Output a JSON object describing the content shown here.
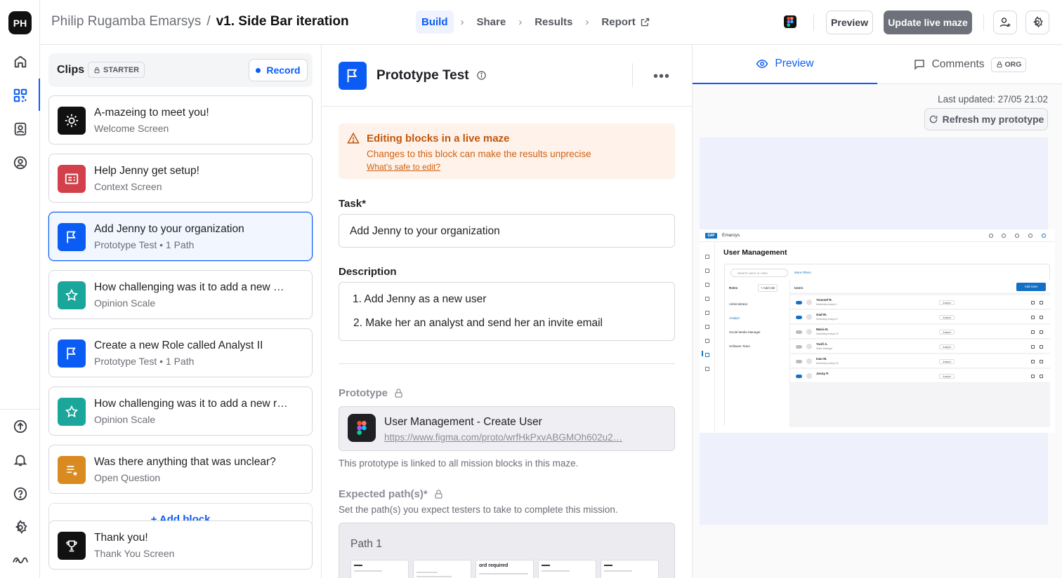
{
  "user": {
    "initials": "PH"
  },
  "header": {
    "workspace": "Philip Rugamba Emarsys",
    "separator": "/",
    "maze_name": "v1. Side Bar iteration",
    "steps": [
      "Build",
      "Share",
      "Results",
      "Report"
    ],
    "active_step": "Build",
    "preview_label": "Preview",
    "update_label": "Update live maze"
  },
  "clips": {
    "title": "Clips",
    "plan_badge": "STARTER",
    "record_label": "Record",
    "add_block_label": "+ Add block",
    "blocks": [
      {
        "title": "A-mazeing to meet you!",
        "subtitle": "Welcome Screen",
        "icon": "sun-icon",
        "color": "#111111"
      },
      {
        "title": "Help Jenny get setup!",
        "subtitle": "Context Screen",
        "icon": "context-screen-icon",
        "color": "#d2414b"
      },
      {
        "title": "Add Jenny to your organization",
        "subtitle": "Prototype Test • 1 Path",
        "icon": "flag-icon",
        "color": "#0a5cf5",
        "selected": true
      },
      {
        "title": "How challenging was it to add a new …",
        "subtitle": "Opinion Scale",
        "icon": "star-icon",
        "color": "#1aa69a"
      },
      {
        "title": "Create a new Role called Analyst II",
        "subtitle": "Prototype Test • 1 Path",
        "icon": "flag-icon",
        "color": "#0a5cf5"
      },
      {
        "title": "How challenging was it to add a new r…",
        "subtitle": "Opinion Scale",
        "icon": "star-icon",
        "color": "#1aa69a"
      },
      {
        "title": "Was there anything that was unclear?",
        "subtitle": "Open Question",
        "icon": "open-question-icon",
        "color": "#d98a21"
      },
      {
        "title": "Thank you!",
        "subtitle": "Thank You Screen",
        "icon": "trophy-icon",
        "color": "#111111"
      }
    ]
  },
  "editor": {
    "block_title": "Prototype Test",
    "alert": {
      "title": "Editing blocks in a live maze",
      "body": "Changes to this block can make the results unprecise",
      "link": "What's safe to edit?"
    },
    "task_label": "Task*",
    "task_value": "Add Jenny to your organization",
    "description_label": "Description",
    "description_lines": [
      "1. Add Jenny as a new user",
      "2. Make her an analyst and send her an invite email"
    ],
    "prototype_label": "Prototype",
    "prototype_name": "User Management - Create User",
    "prototype_url": "https://www.figma.com/proto/wrfHkPxvABGMOh602u2…",
    "prototype_note": "This prototype is linked to all mission blocks in this maze.",
    "expected_paths_label": "Expected path(s)*",
    "expected_paths_note": "Set the path(s) you expect testers to take to complete this mission.",
    "path_label": "Path 1",
    "path_thumb_text": "ord required"
  },
  "preview": {
    "tab_preview": "Preview",
    "tab_comments": "Comments",
    "org_badge": "ORG",
    "last_updated": "Last updated: 27/05 21:02",
    "refresh_label": "Refresh my prototype",
    "app": {
      "brand": "Emarsys",
      "sap_logo": "SAP",
      "heading": "User Management",
      "search_placeholder": "Search users or roles",
      "more_filters": "More Filters",
      "roles_header": "Roles",
      "add_role": "+ Add role",
      "users_header": "Users",
      "add_user": "Add User",
      "roles": [
        "Administrator",
        "Analyst",
        "Social Media Manager",
        "Software Team"
      ],
      "users": [
        {
          "name": "Youssef R.",
          "role_desc": "Marketing Analyst I",
          "chip": "Analyst",
          "active": true
        },
        {
          "name": "Gad M.",
          "role_desc": "Marketing Analyst II",
          "chip": "Analyst",
          "active": true
        },
        {
          "name": "Maria N.",
          "role_desc": "Marketing Analyst III",
          "chip": "Analyst",
          "active": false
        },
        {
          "name": "Yoofi A.",
          "role_desc": "Sales Manager",
          "chip": "Analyst",
          "active": false
        },
        {
          "name": "Ivan M.",
          "role_desc": "Marketing Analyst III",
          "chip": "Analyst",
          "active": false
        },
        {
          "name": "Jenny P.",
          "role_desc": "",
          "chip": "Analyst",
          "active": true
        }
      ]
    }
  }
}
